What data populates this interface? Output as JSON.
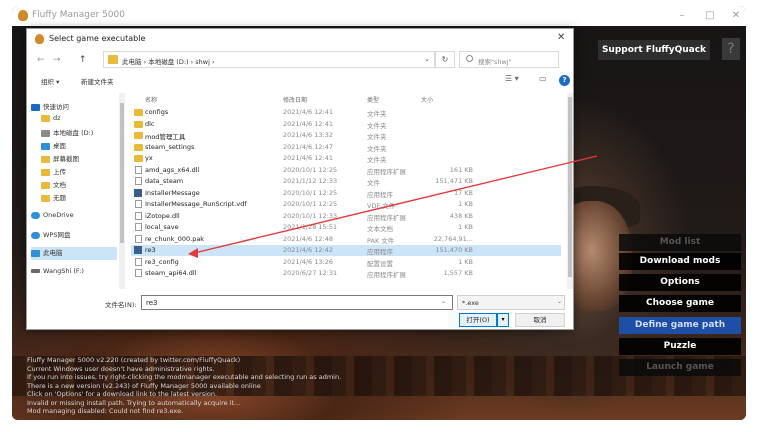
{
  "app": {
    "title": "Fluffy Manager 5000",
    "minimize": "–",
    "maximize": "□",
    "close": "✕",
    "support_label": "Support FluffyQuack",
    "help_label": "?",
    "menu": [
      {
        "label": "Mod list",
        "state": "disabled"
      },
      {
        "label": "Download mods",
        "state": "normal"
      },
      {
        "label": "Options",
        "state": "normal"
      },
      {
        "label": "Choose game",
        "state": "normal"
      },
      {
        "label": "Define game path",
        "state": "selected"
      },
      {
        "label": "Puzzle",
        "state": "normal"
      },
      {
        "label": "Launch game",
        "state": "disabled"
      }
    ],
    "log": [
      "Fluffy Manager 5000 v2.220 (created by twitter.com/FluffyQuack)",
      "Current Windows user doesn't have administrative rights.",
      "If you run into issues, try right-clicking the modmanager executable and selecting run as admin.",
      "There is a new version (v2.243) of Fluffy Manager 5000 available online",
      "Click on 'Options' for a download link to the latest version.",
      "Invalid or missing install path. Trying to automatically acquire it...",
      "Mod managing disabled: Could not find re3.exe."
    ]
  },
  "dialog": {
    "title": "Select game executable",
    "close": "✕",
    "nav": {
      "back": "←",
      "forward": "→",
      "up": "↑"
    },
    "address": "此电脑  ›  本地磁盘 (D:)  ›  shwj  ›",
    "refresh": "↻",
    "search_placeholder": "搜索\"shwj\"",
    "toolbar": {
      "organize": "组织 ▾",
      "new_folder": "新建文件夹"
    },
    "sidebar": [
      {
        "label": "快速访问",
        "color": "#1a6bc4"
      },
      {
        "label": "dz",
        "color": "#e8b93a"
      },
      {
        "label": "本地磁盘 (D:)",
        "color": "#8a8a8a"
      },
      {
        "label": "桌面",
        "color": "#2f8fd8"
      },
      {
        "label": "屏幕截图",
        "color": "#e8b93a"
      },
      {
        "label": "上传",
        "color": "#e8b93a"
      },
      {
        "label": "文档",
        "color": "#e8b93a"
      },
      {
        "label": "无题",
        "color": "#e8b93a"
      },
      {
        "label": "OneDrive",
        "color": "#2f8fd8"
      },
      {
        "label": "WPS网盘",
        "color": "#2f8fd8"
      },
      {
        "label": "此电脑",
        "color": "#2f8fd8"
      },
      {
        "label": "WangShi (F:)",
        "color": "#6a6a6a"
      }
    ],
    "columns": {
      "name": "名称",
      "date": "修改日期",
      "type": "类型",
      "size": "大小"
    },
    "files": [
      {
        "name": "configs",
        "date": "2021/4/6 12:41",
        "type": "文件夹",
        "size": "",
        "kind": "folder"
      },
      {
        "name": "dlc",
        "date": "2021/4/6 12:41",
        "type": "文件夹",
        "size": "",
        "kind": "folder"
      },
      {
        "name": "mod管理工具",
        "date": "2021/4/6 13:32",
        "type": "文件夹",
        "size": "",
        "kind": "folder"
      },
      {
        "name": "steam_settings",
        "date": "2021/4/6 12:47",
        "type": "文件夹",
        "size": "",
        "kind": "folder"
      },
      {
        "name": "yx",
        "date": "2021/4/6 12:41",
        "type": "文件夹",
        "size": "",
        "kind": "folder"
      },
      {
        "name": "amd_ags_x64.dll",
        "date": "2020/10/1 12:25",
        "type": "应用程序扩展",
        "size": "161 KB",
        "kind": "file"
      },
      {
        "name": "data_steam",
        "date": "2021/1/12 12:33",
        "type": "文件",
        "size": "151,471 KB",
        "kind": "file"
      },
      {
        "name": "InstallerMessage",
        "date": "2020/10/1 12:25",
        "type": "应用程序",
        "size": "17 KB",
        "kind": "exe"
      },
      {
        "name": "InstallerMessage_RunScript.vdf",
        "date": "2020/10/1 12:25",
        "type": "VDF 文件",
        "size": "1 KB",
        "kind": "file"
      },
      {
        "name": "iZotope.dll",
        "date": "2020/10/1 12:33",
        "type": "应用程序扩展",
        "size": "438 KB",
        "kind": "file"
      },
      {
        "name": "local_save",
        "date": "2021/1/28 15:51",
        "type": "文本文档",
        "size": "1 KB",
        "kind": "file"
      },
      {
        "name": "re_chunk_000.pak",
        "date": "2021/4/6 12:48",
        "type": "PAK 文件",
        "size": "22,764,91...",
        "kind": "file"
      },
      {
        "name": "re3",
        "date": "2021/4/6 12:42",
        "type": "应用程序",
        "size": "151,470 KB",
        "kind": "exe",
        "selected": true
      },
      {
        "name": "re3_config",
        "date": "2021/4/6 13:26",
        "type": "配置设置",
        "size": "1 KB",
        "kind": "file"
      },
      {
        "name": "steam_api64.dll",
        "date": "2020/6/27 12:31",
        "type": "应用程序扩展",
        "size": "1,557 KB",
        "kind": "file"
      }
    ],
    "filename_label": "文件名(N):",
    "filename_value": "re3",
    "filter_value": "*.exe",
    "open_label": "打开(O)",
    "cancel_label": "取消"
  }
}
